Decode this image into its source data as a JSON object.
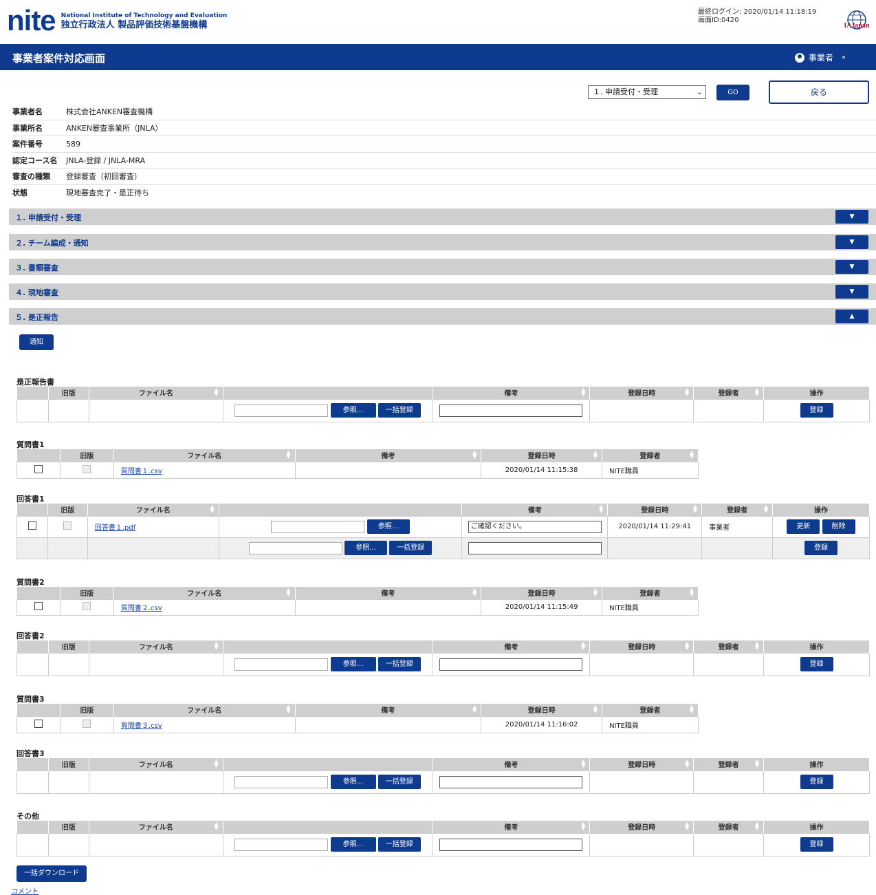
{
  "header": {
    "logo_mark": "nite",
    "logo_en": "National Institute of Technology and Evaluation",
    "logo_jp": "独立行政法人 製品評価技術基盤機構",
    "last_login": "最終ログイン: 2020/01/14 11:18:19",
    "screen_id": "画面ID:0420",
    "partner_logo": "IAJapan"
  },
  "titlebar": {
    "title": "事業者案件対応画面",
    "user": "事業者",
    "chevron": "»"
  },
  "nav": {
    "stage_select": "１. 申請受付・受理",
    "go": "GO",
    "back": "戻る"
  },
  "info": [
    {
      "k": "事業者名",
      "v": "株式会社ANKEN審査機構"
    },
    {
      "k": "事業所名",
      "v": "ANKEN審査事業所（JNLA）"
    },
    {
      "k": "案件番号",
      "v": "589"
    },
    {
      "k": "認定コース名",
      "v": "JNLA-登録 / JNLA-MRA"
    },
    {
      "k": "審査の種類",
      "v": "登録審査（初回審査）"
    },
    {
      "k": "状態",
      "v": "現地審査完了・是正待ち"
    }
  ],
  "accordions": [
    {
      "title": "１. 申請受付・受理",
      "toggle": "▼"
    },
    {
      "title": "２. チーム編成・通知",
      "toggle": "▼"
    },
    {
      "title": "３. 書類審査",
      "toggle": "▼"
    },
    {
      "title": "４. 現地審査",
      "toggle": "▼"
    },
    {
      "title": "５. 是正報告",
      "toggle": "▲"
    }
  ],
  "notify": "通知",
  "labels": {
    "old": "旧版",
    "file": "ファイル名",
    "remarks": "備考",
    "regdate": "登録日時",
    "registrant": "登録者",
    "ops": "操作",
    "browse": "参照...",
    "bulk_register": "一括登録",
    "register": "登録",
    "update": "更新",
    "delete": "削除"
  },
  "sections": {
    "corrective": "是正報告書",
    "q1": {
      "title": "質問書1",
      "file": "質問書１.csv",
      "date": "2020/01/14 11:15:38",
      "by": "NITE職員"
    },
    "a1": {
      "title": "回答書1",
      "file": "回答書１.pdf",
      "remark": "ご確認ください。",
      "date": "2020/01/14 11:29:41",
      "by": "事業者"
    },
    "q2": {
      "title": "質問書2",
      "file": "質問書２.csv",
      "date": "2020/01/14 11:15:49",
      "by": "NITE職員"
    },
    "a2": "回答書2",
    "q3": {
      "title": "質問書3",
      "file": "質問書３.csv",
      "date": "2020/01/14 11:16:02",
      "by": "NITE職員"
    },
    "a3": "回答書3",
    "other": "その他"
  },
  "bottom": {
    "bulk_download": "一括ダウンロード",
    "comment": "コメント"
  }
}
